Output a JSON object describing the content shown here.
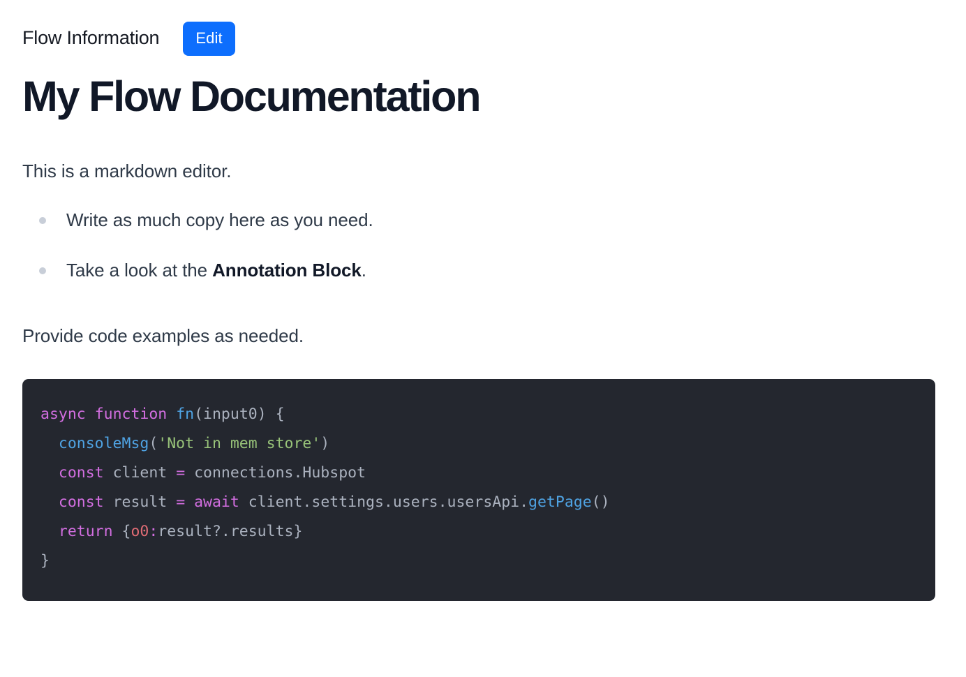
{
  "header": {
    "section_label": "Flow Information",
    "edit_label": "Edit",
    "edit_button_color": "#0d6efd"
  },
  "document": {
    "title": "My Flow Documentation",
    "intro_paragraph": "This is a markdown editor.",
    "bullets": [
      {
        "text_before": "Write as much copy here as you need.",
        "bold": "",
        "text_after": ""
      },
      {
        "text_before": "Take a look at the ",
        "bold": "Annotation Block",
        "text_after": "."
      }
    ],
    "code_intro_paragraph": "Provide code examples as needed."
  },
  "code_block": {
    "background_color": "#24272f",
    "language": "javascript",
    "plain_text": "async function fn(input0) {\n  consoleMsg('Not in mem store')\n  const client = connections.Hubspot\n  const result = await client.settings.users.usersApi.getPage()\n  return {o0:result?.results}\n}",
    "lines": [
      {
        "index": 1,
        "tokens": [
          {
            "t": "async",
            "c": "kw"
          },
          {
            "t": " ",
            "c": "punc"
          },
          {
            "t": "function",
            "c": "kw"
          },
          {
            "t": " ",
            "c": "punc"
          },
          {
            "t": "fn",
            "c": "fn"
          },
          {
            "t": "(",
            "c": "punc"
          },
          {
            "t": "input0",
            "c": "id"
          },
          {
            "t": ") {",
            "c": "punc"
          }
        ]
      },
      {
        "index": 2,
        "tokens": [
          {
            "t": "  ",
            "c": "punc"
          },
          {
            "t": "consoleMsg",
            "c": "fn"
          },
          {
            "t": "(",
            "c": "punc"
          },
          {
            "t": "'Not in mem store'",
            "c": "str"
          },
          {
            "t": ")",
            "c": "punc"
          }
        ]
      },
      {
        "index": 3,
        "tokens": [
          {
            "t": "  ",
            "c": "punc"
          },
          {
            "t": "const",
            "c": "kw"
          },
          {
            "t": " client ",
            "c": "id"
          },
          {
            "t": "=",
            "c": "kw"
          },
          {
            "t": " connections.Hubspot",
            "c": "id"
          }
        ]
      },
      {
        "index": 4,
        "tokens": [
          {
            "t": "  ",
            "c": "punc"
          },
          {
            "t": "const",
            "c": "kw"
          },
          {
            "t": " result ",
            "c": "id"
          },
          {
            "t": "=",
            "c": "kw"
          },
          {
            "t": " ",
            "c": "id"
          },
          {
            "t": "await",
            "c": "kw"
          },
          {
            "t": " client.settings.users.usersApi.",
            "c": "id"
          },
          {
            "t": "getPage",
            "c": "fn"
          },
          {
            "t": "()",
            "c": "punc"
          }
        ]
      },
      {
        "index": 5,
        "tokens": [
          {
            "t": "  ",
            "c": "punc"
          },
          {
            "t": "return",
            "c": "kw"
          },
          {
            "t": " {",
            "c": "punc"
          },
          {
            "t": "o0",
            "c": "key"
          },
          {
            "t": ":",
            "c": "colon"
          },
          {
            "t": "result?.results}",
            "c": "id"
          }
        ]
      },
      {
        "index": 6,
        "tokens": [
          {
            "t": "}",
            "c": "punc"
          }
        ]
      }
    ]
  }
}
